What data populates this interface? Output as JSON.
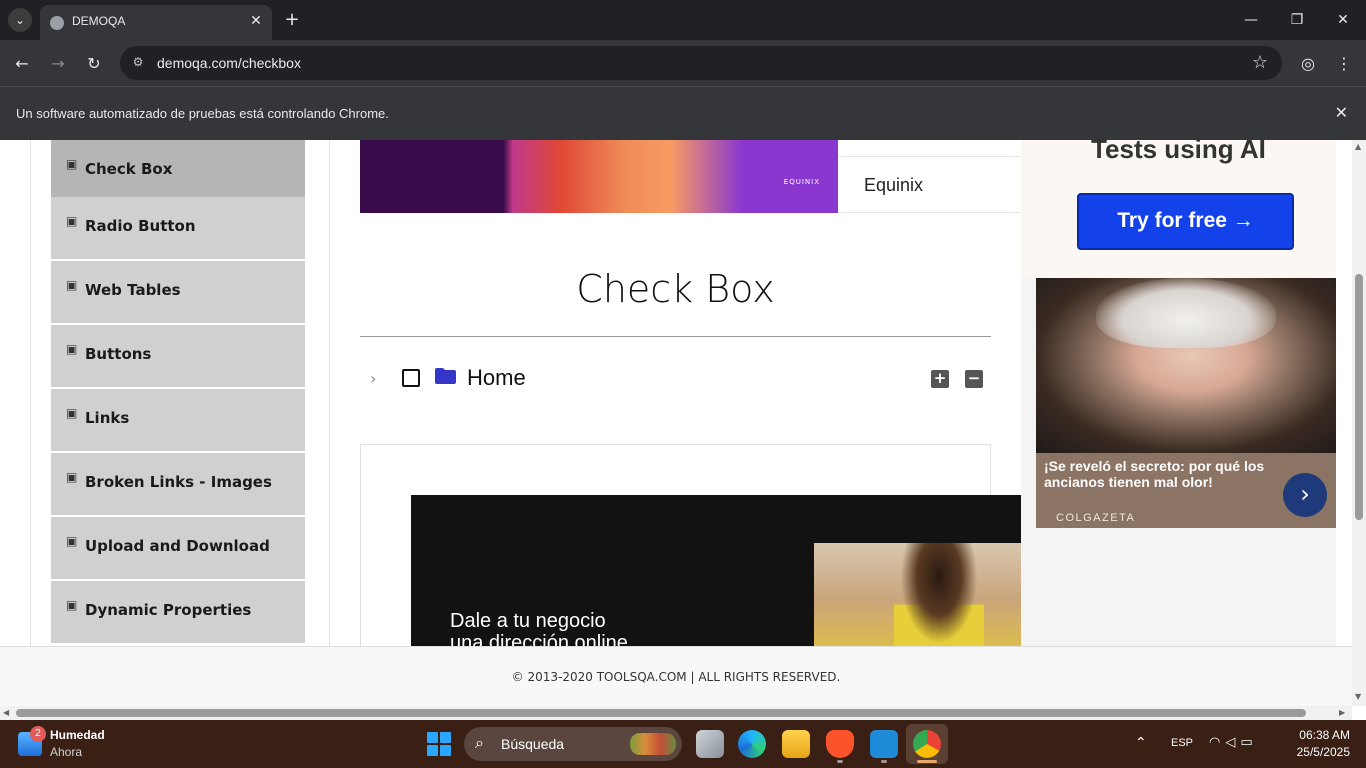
{
  "browser": {
    "tab_title": "DEMOQA",
    "url": "demoqa.com/checkbox",
    "infobar_text": "Un software automatizado de pruebas está controlando Chrome."
  },
  "sidebar": {
    "items": [
      {
        "label": "Check Box",
        "active": true
      },
      {
        "label": "Radio Button"
      },
      {
        "label": "Web Tables"
      },
      {
        "label": "Buttons"
      },
      {
        "label": "Links"
      },
      {
        "label": "Broken Links - Images"
      },
      {
        "label": "Upload and Download"
      },
      {
        "label": "Dynamic Properties"
      }
    ]
  },
  "top_ad": {
    "logo_text": "EQUINIX",
    "advertiser": "Equinix"
  },
  "main": {
    "title": "Check Box",
    "tree": {
      "node_label": "Home",
      "expand_all": "+",
      "collapse_all": "−"
    }
  },
  "bottom_ad": {
    "line1": "Dale a tu negocio",
    "line2": "una dirección online"
  },
  "right_ad": {
    "headline": "Tests using AI",
    "cta": "Try for free →"
  },
  "side_ad": {
    "caption": "¡Se reveló el secreto: por qué los ancianos tienen mal olor!",
    "source": "COLGAZETA"
  },
  "footer": {
    "text": "© 2013-2020 TOOLSQA.COM | ALL RIGHTS RESERVED."
  },
  "taskbar": {
    "weather_badge": "2",
    "weather_title": "Humedad",
    "weather_sub": "Ahora",
    "search_label": "Búsqueda",
    "language": "ESP",
    "time": "06:38 AM",
    "date": "25/5/2025"
  },
  "colors": {
    "accent_blue": "#1442ea",
    "folder_blue": "#3535c8",
    "sidebar_active": "#b5b5b5",
    "sidebar_item": "#d0d0d0"
  }
}
